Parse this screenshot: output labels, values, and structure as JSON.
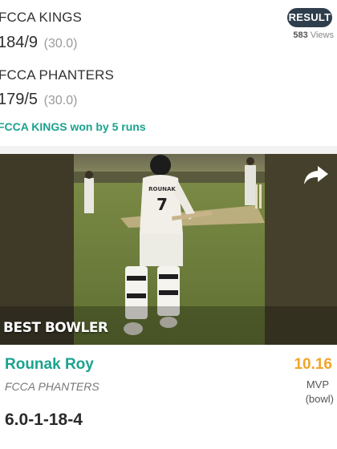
{
  "match": {
    "team1": {
      "name": "FCCA KINGS",
      "score": "184/9",
      "overs": "(30.0)"
    },
    "team2": {
      "name": "FCCA PHANTERS",
      "score": "179/5",
      "overs": "(30.0)"
    },
    "result_badge": "RESULT",
    "views_count": "583",
    "views_label": "Views",
    "result_text": "FCCA KINGS won by 5 runs"
  },
  "highlight": {
    "label": "BEST BOWLER",
    "player_name": "Rounak Roy",
    "player_team": "FCCA PHANTERS",
    "figures": "6.0-1-18-4",
    "mvp_points": "10.16",
    "mvp_label": "MVP",
    "mvp_type": "(bowl)",
    "jersey_name": "ROUNAK",
    "jersey_number": "7"
  },
  "colors": {
    "accent_teal": "#1aa38e",
    "badge_dark": "#2f3e4c",
    "mvp_orange": "#f0a52a"
  },
  "icons": {
    "share": "share-arrow-icon"
  }
}
